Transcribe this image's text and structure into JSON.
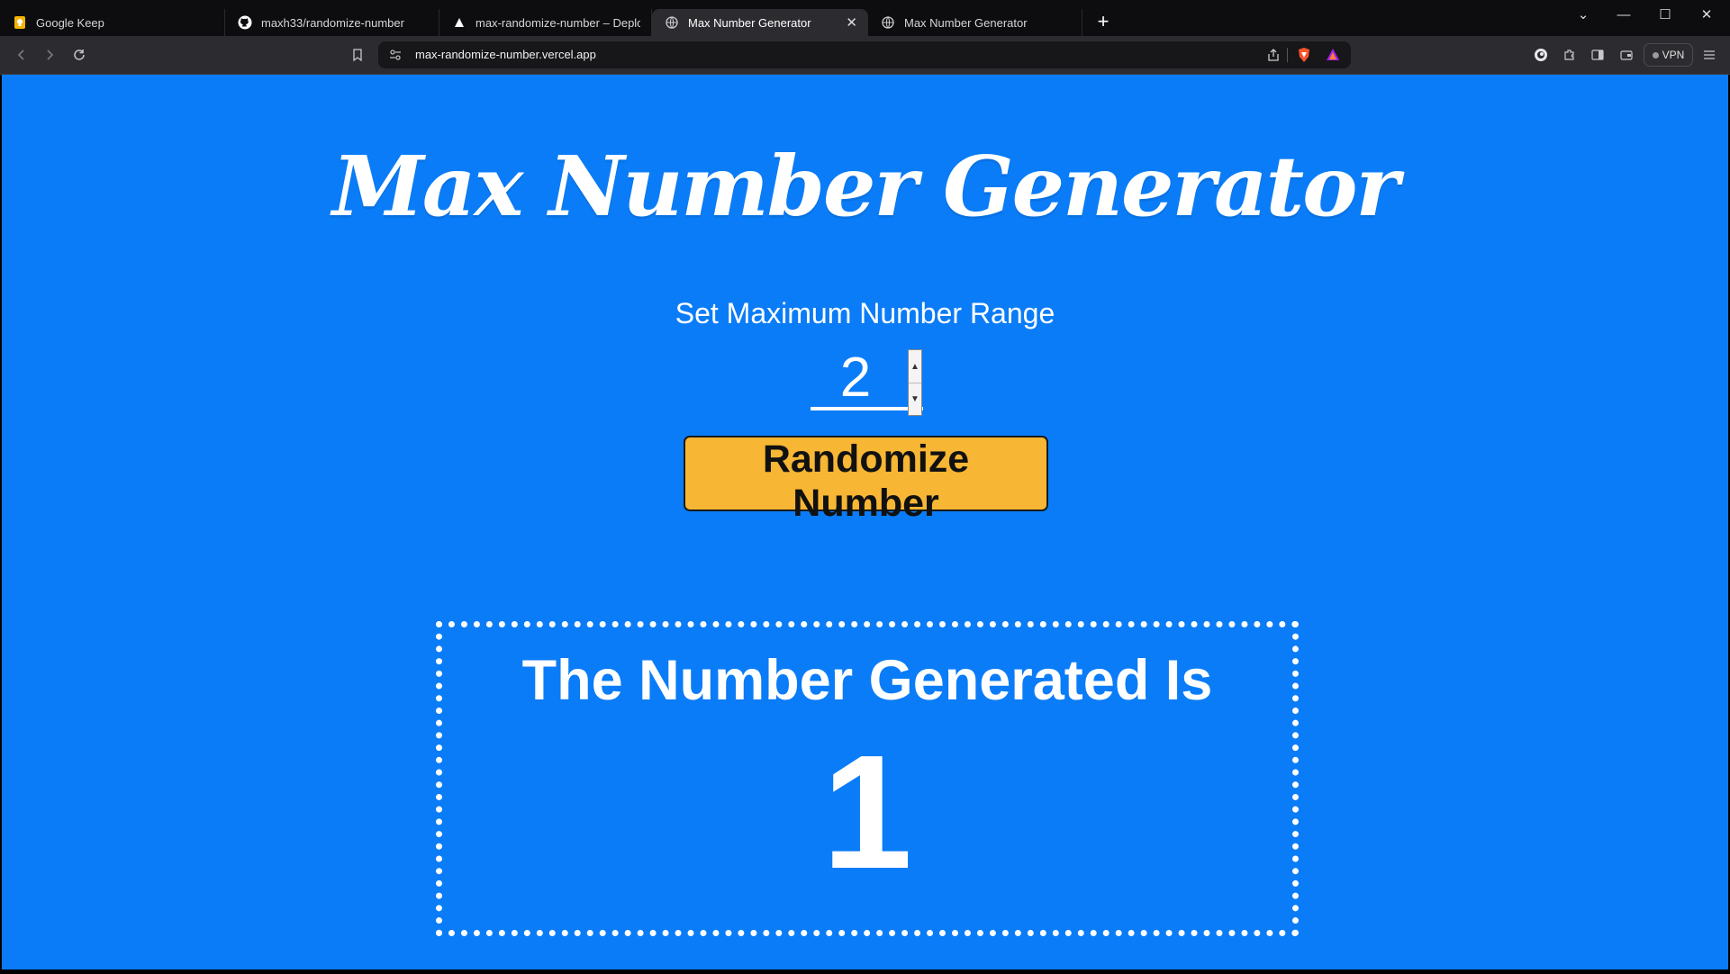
{
  "browser": {
    "tabs": [
      {
        "label": "Google Keep",
        "icon": "google-keep-icon",
        "active": false
      },
      {
        "label": "maxh33/randomize-number",
        "icon": "github-icon",
        "active": false
      },
      {
        "label": "max-randomize-number – Deployment",
        "icon": "vercel-icon",
        "active": false
      },
      {
        "label": "Max Number Generator",
        "icon": "globe-icon",
        "active": true
      },
      {
        "label": "Max Number Generator",
        "icon": "globe-icon",
        "active": false
      }
    ],
    "url": "max-randomize-number.vercel.app",
    "vpn_label": "VPN",
    "colors": {
      "tabbar": "#0d0d10",
      "toolbar": "#2c2c30"
    }
  },
  "page": {
    "title": "Max Number Generator",
    "range_label": "Set Maximum Number Range",
    "max_value": "2",
    "button_label": "Randomize Number",
    "result_heading": "The Number Generated Is",
    "result_value": "1",
    "colors": {
      "background": "#0a7cf7",
      "button": "#f7b634",
      "text": "#ffffff"
    }
  }
}
